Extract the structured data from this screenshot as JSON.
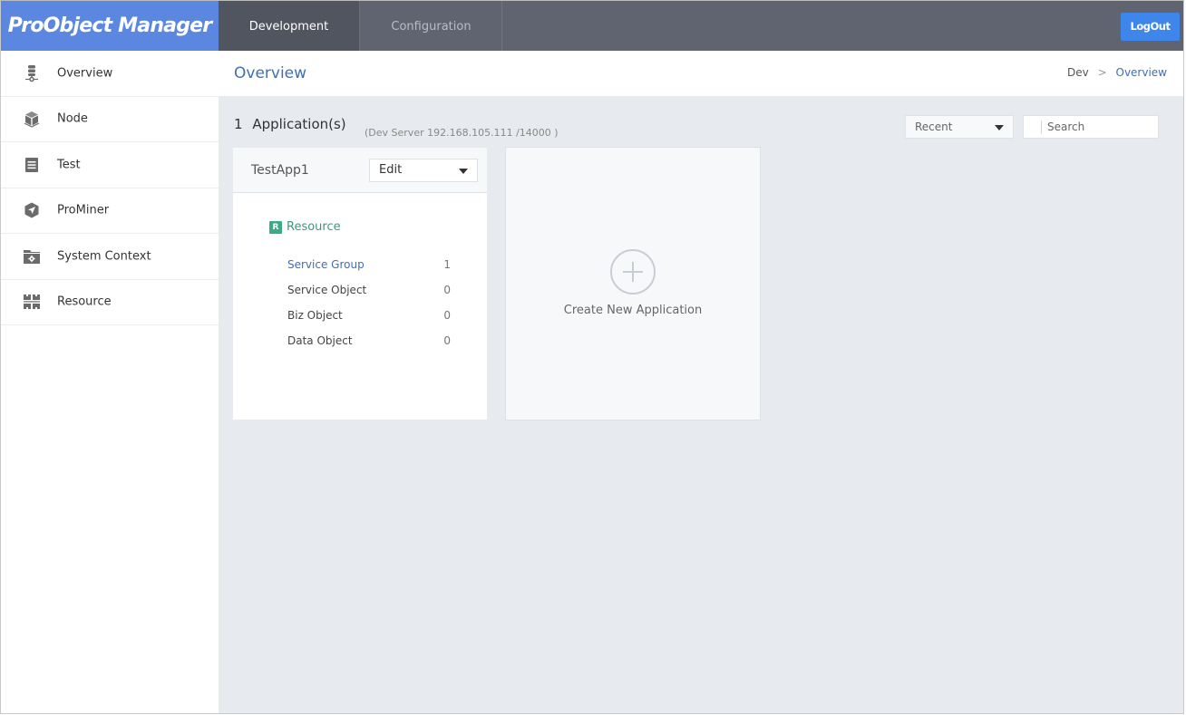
{
  "app": {
    "title": "ProObject Manager"
  },
  "topnav": {
    "tabs": [
      {
        "label": "Development",
        "active": true
      },
      {
        "label": "Configuration",
        "active": false
      }
    ],
    "logout_label": "LogOut"
  },
  "sidebar": {
    "items": [
      {
        "label": "Overview",
        "icon": "database-icon"
      },
      {
        "label": "Node",
        "icon": "cube-icon"
      },
      {
        "label": "Test",
        "icon": "document-icon"
      },
      {
        "label": "ProMiner",
        "icon": "hexagon-navigation-icon"
      },
      {
        "label": "System Context",
        "icon": "folder-gear-icon"
      },
      {
        "label": "Resource",
        "icon": "grid-blocks-icon"
      }
    ]
  },
  "header": {
    "title": "Overview",
    "breadcrumb": {
      "root": "Dev",
      "separator": ">",
      "current": "Overview"
    }
  },
  "summary": {
    "count": "1",
    "label": "Application(s)",
    "server_info": "(Dev Server  192.168.105.111 /14000 )"
  },
  "filters": {
    "sort_selected": "Recent",
    "search_placeholder": "Search",
    "search_value": ""
  },
  "applications": [
    {
      "name": "TestApp1",
      "action_selected": "Edit",
      "resource": {
        "badge": "R",
        "title": "Resource",
        "rows": [
          {
            "label": "Service Group",
            "value": "1"
          },
          {
            "label": "Service Object",
            "value": "0"
          },
          {
            "label": "Biz Object",
            "value": "0"
          },
          {
            "label": "Data Object",
            "value": "0"
          }
        ]
      }
    }
  ],
  "create_card": {
    "label": "Create New Application"
  },
  "colors": {
    "brand": "#5b87e0",
    "topbar": "#5f6470",
    "active_tab": "#51555f",
    "logout": "#3e86ea",
    "link": "#3f6fb6",
    "resource_green": "#3caa87",
    "main_bg": "#e7ebef"
  }
}
